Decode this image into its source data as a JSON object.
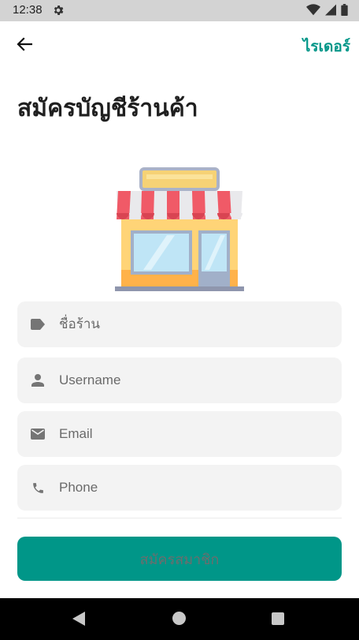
{
  "status_bar": {
    "time": "12:38"
  },
  "header": {
    "rider_link": "ไรเดอร์"
  },
  "title": "สมัครบัญชีร้านค้า",
  "form": {
    "shop_name": {
      "placeholder": "ชื่อร้าน",
      "value": ""
    },
    "username": {
      "placeholder": "Username",
      "value": ""
    },
    "email": {
      "placeholder": "Email",
      "value": ""
    },
    "phone": {
      "placeholder": "Phone",
      "value": ""
    }
  },
  "submit_label": "สมัครสมาชิก",
  "colors": {
    "accent": "#009688",
    "field_bg": "#f3f3f3"
  },
  "icons": {
    "shop_name": "label-icon",
    "username": "person-icon",
    "email": "mail-icon",
    "phone": "phone-icon"
  }
}
